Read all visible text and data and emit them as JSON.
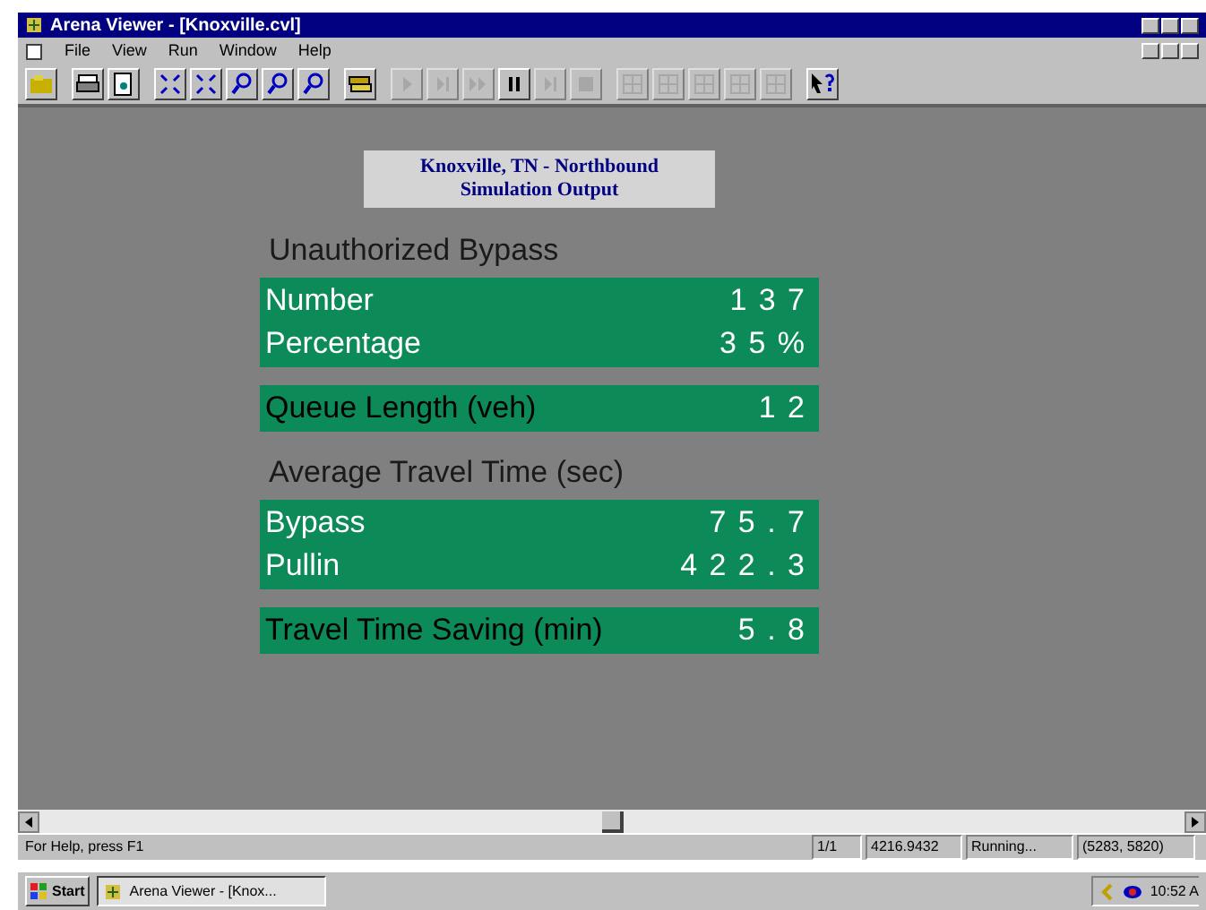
{
  "window": {
    "title": "Arena Viewer - [Knoxville.cvl]"
  },
  "menu": [
    "File",
    "View",
    "Run",
    "Window",
    "Help"
  ],
  "toolbar": [
    {
      "kind": "open",
      "disabled": false
    },
    {
      "kind": "sep"
    },
    {
      "kind": "print",
      "disabled": false
    },
    {
      "kind": "preview",
      "disabled": false
    },
    {
      "kind": "sep"
    },
    {
      "kind": "fit",
      "disabled": false
    },
    {
      "kind": "fit",
      "disabled": false
    },
    {
      "kind": "zoom",
      "disabled": false
    },
    {
      "kind": "zoom",
      "disabled": false
    },
    {
      "kind": "zoom",
      "disabled": false
    },
    {
      "kind": "sep"
    },
    {
      "kind": "layers",
      "disabled": false
    },
    {
      "kind": "sep"
    },
    {
      "kind": "play",
      "disabled": true
    },
    {
      "kind": "step",
      "disabled": true
    },
    {
      "kind": "fast",
      "disabled": true
    },
    {
      "kind": "pause",
      "disabled": false
    },
    {
      "kind": "step",
      "disabled": true
    },
    {
      "kind": "stop",
      "disabled": true
    },
    {
      "kind": "sep"
    },
    {
      "kind": "grid",
      "disabled": true
    },
    {
      "kind": "grid",
      "disabled": true
    },
    {
      "kind": "grid",
      "disabled": true
    },
    {
      "kind": "grid",
      "disabled": true
    },
    {
      "kind": "grid",
      "disabled": true
    },
    {
      "kind": "sep"
    },
    {
      "kind": "help",
      "disabled": false
    }
  ],
  "header": [
    "Knoxville, TN - Northbound",
    "Simulation Output"
  ],
  "sections": [
    {
      "kind": "heading",
      "text": "Unauthorized Bypass"
    },
    {
      "kind": "panel_light",
      "rows": [
        {
          "label": "Number",
          "value": "1 3 7"
        },
        {
          "label": "Percentage",
          "value": "3 5 %"
        }
      ]
    },
    {
      "kind": "panel_dark",
      "rows": [
        {
          "label": "Queue Length (veh)",
          "value": "1 2"
        }
      ]
    },
    {
      "kind": "heading",
      "text": "Average Travel Time (sec)"
    },
    {
      "kind": "panel_light",
      "rows": [
        {
          "label": "Bypass",
          "value": "7 5 . 7"
        },
        {
          "label": "Pullin",
          "value": "4 2 2 . 3"
        }
      ]
    },
    {
      "kind": "panel_dark",
      "rows": [
        {
          "label": "Travel Time Saving (min)",
          "value": "5 . 8"
        }
      ]
    }
  ],
  "status_bar": {
    "message": "For Help, press F1",
    "panes": [
      "1/1",
      "4216.9432",
      "Running...",
      "(5283, 5820)"
    ]
  },
  "taskbar": {
    "start": "Start",
    "tasks": [
      "Arena Viewer - [Knox..."
    ],
    "clock": "10:52 A"
  }
}
